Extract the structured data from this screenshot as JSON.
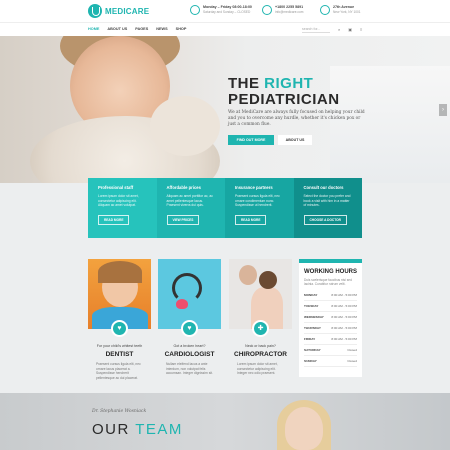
{
  "header": {
    "logo": "MEDICARE",
    "contacts": [
      {
        "icon": "clock-icon",
        "line1": "Monday – Friday 08:00-18:00",
        "line2": "Saturday and Sunday – CLOSED"
      },
      {
        "icon": "phone-icon",
        "line1": "+1800 2255 5891",
        "line2": "info@medicare.com"
      },
      {
        "icon": "location-icon",
        "line1": "27th Avenue",
        "line2": "New York, NY 1001"
      }
    ]
  },
  "nav": {
    "items": [
      "HOME",
      "ABOUT US",
      "PAGES",
      "NEWS",
      "SHOP"
    ],
    "search_placeholder": "search for..."
  },
  "hero": {
    "title_a": "THE ",
    "title_b": "RIGHT",
    "title_c": "PEDIATRICIAN",
    "text": "We at MediCare are always fully focused on helping your child and you to overcome any hurdle, whether it's chicken pox or just a common flue.",
    "primary_button": "FIND OUT MORE",
    "secondary_button": "ABOUT US"
  },
  "features": [
    {
      "title": "Professional staff",
      "text": "Lorem ipsum dolor sit amet, consectetur adipiscing elit. Aliquam ac amet volutpat.",
      "button": "READ MORE",
      "color": "#26c3bc"
    },
    {
      "title": "Affordable prices",
      "text": "Aliquam ac amet porttitor ac, ac amet pellentesque lacus. Praesent viverra dui quis.",
      "button": "VIEW PRICES",
      "color": "#1fb5b0"
    },
    {
      "title": "Insurance partners",
      "text": "Praesent cursus ligula elit, nec ornare condimentum nunc. Suspendisse ut hendrerit.",
      "button": "READ MORE",
      "color": "#17a6a2"
    },
    {
      "title": "Consult our doctors",
      "text": "Select the doctor you prefer and book a visit with him in a matter of minutes.",
      "button": "CHOOSE A DOCTOR",
      "color": "#108f8c"
    }
  ],
  "cards": [
    {
      "subtitle": "For your child's whitest teeth",
      "title": "DENTIST",
      "icon": "tooth-icon",
      "desc": "Praesent cursus ligula elit, nec ornare lacus placerat a. Suspendisse hendrerit pellentesque ac dui placerat."
    },
    {
      "subtitle": "Got a broken heart?",
      "title": "CARDIOLOGIST",
      "icon": "heart-icon",
      "desc": "Nullam eleifend lacus a ante interdum, non volutpat felis accumsan. Integer dignissim sit."
    },
    {
      "subtitle": "Neck or back pain?",
      "title": "CHIROPRACTOR",
      "icon": "spine-icon",
      "desc": "Lorem ipsum dolor sit amet, consectetur adipiscing elit. Integer nec odio praesent."
    }
  ],
  "hours": {
    "title": "WORKING HOURS",
    "desc": "Duis scelerisque faucibus nisi sed lacinia. Curabitur rutrum velit.",
    "rows": [
      {
        "day": "MONDAY",
        "time": "8:00 AM - 5:00 PM"
      },
      {
        "day": "TUESDAY",
        "time": "8:00 AM - 5:00 PM"
      },
      {
        "day": "WEDNESDAY",
        "time": "8:00 AM - 5:00 PM"
      },
      {
        "day": "THURSDAY",
        "time": "8:00 AM - 5:00 PM"
      },
      {
        "day": "FRIDAY",
        "time": "8:00 AM - 5:00 PM"
      },
      {
        "day": "SATURDAY",
        "time": "Closed"
      },
      {
        "day": "SUNDAY",
        "time": "Closed"
      }
    ]
  },
  "team": {
    "doctor": "Dr. Stephanie Wosniack",
    "title_a": "OUR ",
    "title_b": "TEAM"
  }
}
